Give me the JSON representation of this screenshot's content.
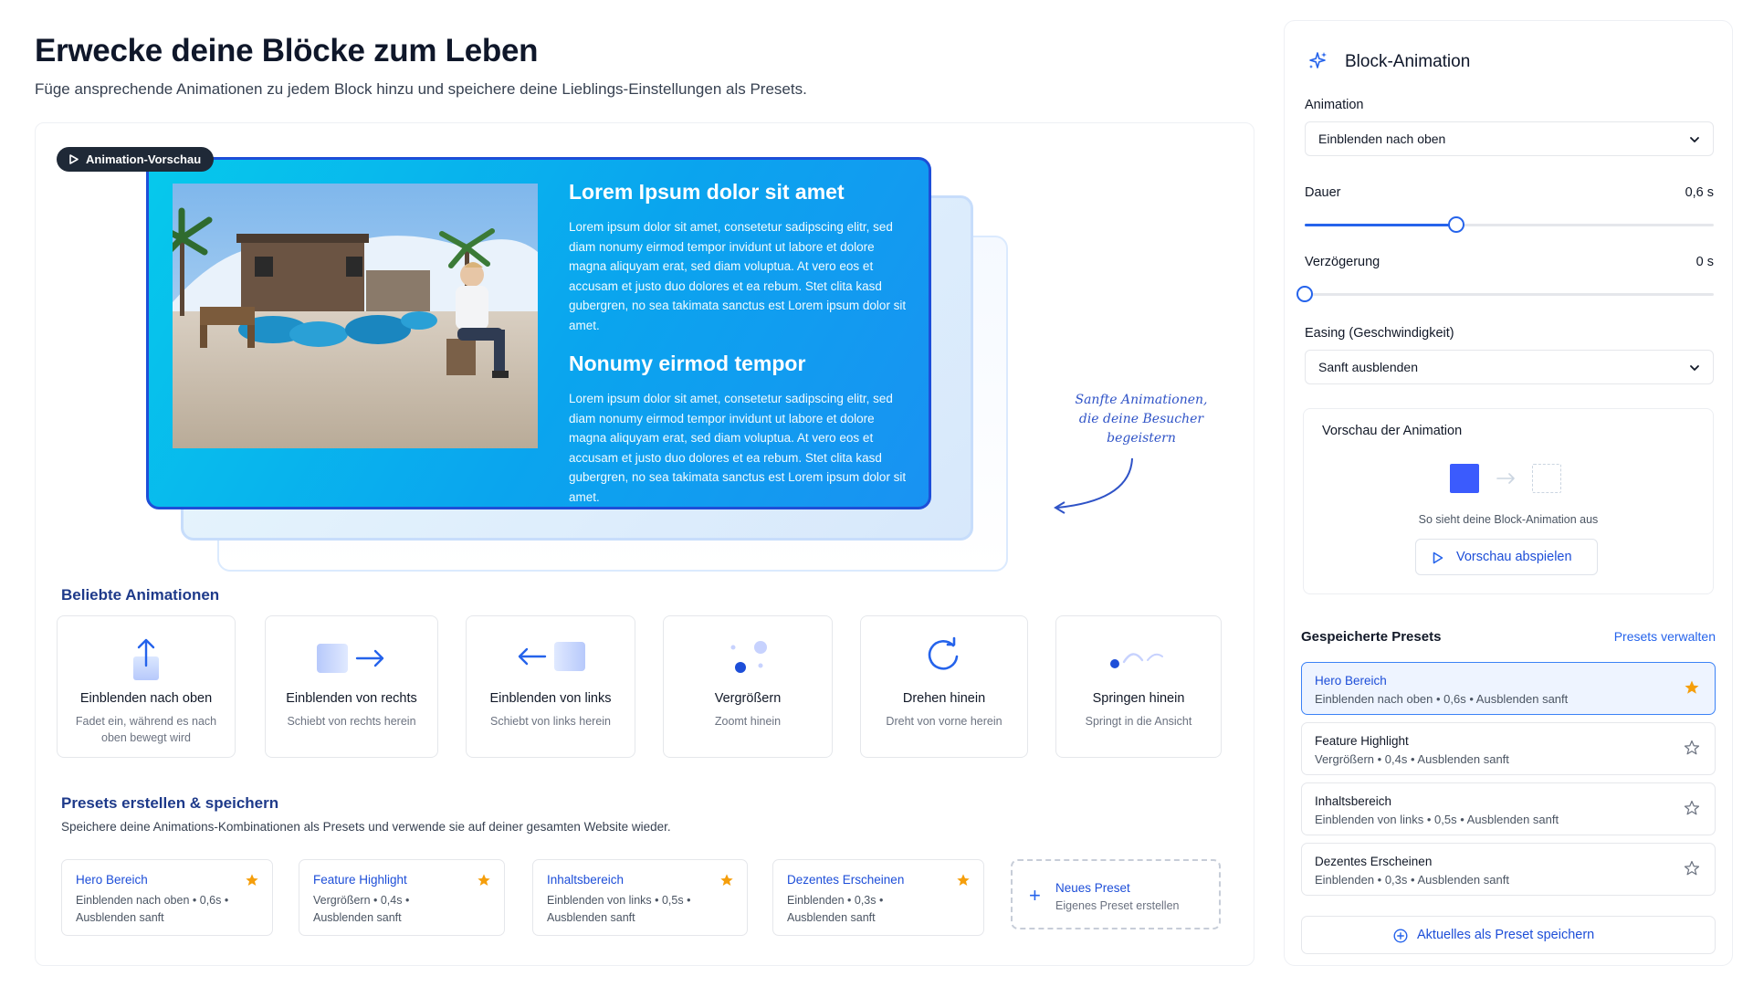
{
  "header": {
    "title": "Erwecke deine Blöcke zum Leben",
    "subtitle": "Füge ansprechende Animationen zu jedem Block hinzu und speichere deine Lieblings-Einstellungen als Presets."
  },
  "preview": {
    "badge": "Animation-Vorschau",
    "heading1": "Lorem Ipsum dolor sit amet",
    "paragraph1": "Lorem ipsum dolor sit amet, consetetur sadipscing elitr, sed diam nonumy eirmod tempor invidunt ut labore et dolore magna aliquyam erat, sed diam voluptua. At vero eos et accusam et justo duo dolores et ea rebum. Stet clita kasd gubergren, no sea takimata sanctus est Lorem ipsum dolor sit amet.",
    "heading2": "Nonumy eirmod tempor",
    "paragraph2": "Lorem ipsum dolor sit amet, consetetur sadipscing elitr, sed diam nonumy eirmod tempor invidunt ut labore et dolore magna aliquyam erat, sed diam voluptua. At vero eos et accusam et justo duo dolores et ea rebum. Stet clita kasd gubergren, no sea takimata sanctus est Lorem ipsum dolor sit amet.",
    "handwritten_line1": "Sanfte Animationen,",
    "handwritten_line2": "die deine Besucher",
    "handwritten_line3": "begeistern"
  },
  "popular": {
    "heading": "Beliebte Animationen",
    "items": [
      {
        "title": "Einblenden nach oben",
        "desc": "Fadet ein, während es nach oben bewegt wird",
        "icon": "arrow-up-icon"
      },
      {
        "title": "Einblenden von rechts",
        "desc": "Schiebt von rechts herein",
        "icon": "arrow-right-icon"
      },
      {
        "title": "Einblenden von links",
        "desc": "Schiebt von links herein",
        "icon": "arrow-left-icon"
      },
      {
        "title": "Vergrößern",
        "desc": "Zoomt hinein",
        "icon": "zoom-dots-icon"
      },
      {
        "title": "Drehen hinein",
        "desc": "Dreht von vorne herein",
        "icon": "rotate-icon"
      },
      {
        "title": "Springen hinein",
        "desc": "Springt in die Ansicht",
        "icon": "bounce-icon"
      }
    ]
  },
  "presets_section": {
    "heading": "Presets erstellen & speichern",
    "description": "Speichere deine Animations-Kombinationen als Presets und verwende sie auf deiner gesamten Website wieder.",
    "cards": [
      {
        "title": "Hero Bereich",
        "desc": "Einblenden nach oben • 0,6s • Ausblenden sanft"
      },
      {
        "title": "Feature Highlight",
        "desc": "Vergrößern • 0,4s • Ausblenden sanft"
      },
      {
        "title": "Inhaltsbereich",
        "desc": "Einblenden von links • 0,5s • Ausblenden sanft"
      },
      {
        "title": "Dezentes Erscheinen",
        "desc": "Einblenden • 0,3s • Ausblenden sanft"
      }
    ],
    "new_title": "Neues Preset",
    "new_desc": "Eigenes Preset erstellen"
  },
  "panel": {
    "title": "Block-Animation",
    "animation_label": "Animation",
    "animation_value": "Einblenden nach oben",
    "duration_label": "Dauer",
    "duration_value": "0,6 s",
    "duration_fraction": 0.37,
    "delay_label": "Verzögerung",
    "delay_value": "0 s",
    "delay_fraction": 0,
    "easing_label": "Easing (Geschwindigkeit)",
    "easing_value": "Sanft ausblenden",
    "preview_label": "Vorschau der Animation",
    "preview_caption": "So sieht deine Block-Animation aus",
    "preview_button": "Vorschau abspielen",
    "saved_heading": "Gespeicherte Presets",
    "manage_link": "Presets verwalten",
    "saved": [
      {
        "name": "Hero Bereich",
        "desc": "Einblenden nach oben • 0,6s • Ausblenden sanft",
        "favorite": true
      },
      {
        "name": "Feature Highlight",
        "desc": "Vergrößern • 0,4s • Ausblenden sanft",
        "favorite": false
      },
      {
        "name": "Inhaltsbereich",
        "desc": "Einblenden von links • 0,5s • Ausblenden sanft",
        "favorite": false
      },
      {
        "name": "Dezentes Erscheinen",
        "desc": "Einblenden • 0,3s • Ausblenden sanft",
        "favorite": false
      }
    ],
    "save_button": "Aktuelles als Preset speichern"
  },
  "colors": {
    "accent": "#2563eb",
    "heading_blue": "#1e3a8a",
    "star": "#f59e0b",
    "hero_gradient_start": "#06c9ec",
    "hero_gradient_end": "#1992f2"
  }
}
